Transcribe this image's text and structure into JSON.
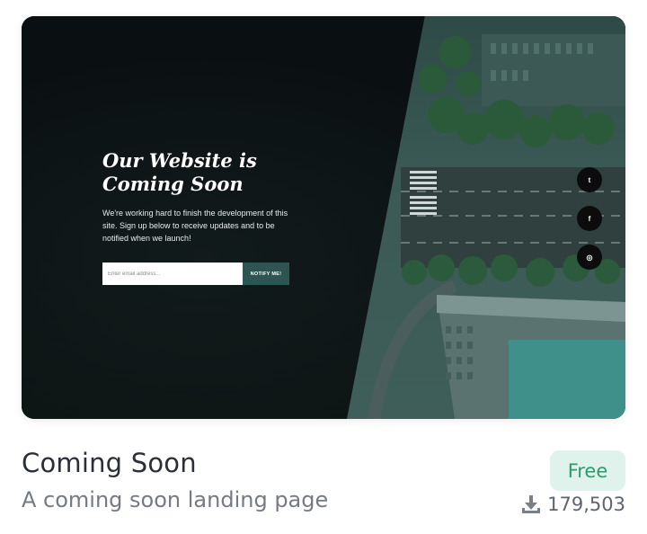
{
  "preview": {
    "headline": "Our Website is Coming Soon",
    "description": "We're working hard to finish the development of this site. Sign up below to receive updates and to be notified when we launch!",
    "email_placeholder": "Enter email address...",
    "notify_label": "NOTIFY ME!",
    "social": {
      "twitter": "twitter-icon",
      "facebook": "facebook-icon",
      "instagram": "instagram-icon",
      "twitter_glyph": "t",
      "facebook_glyph": "f",
      "instagram_glyph": "◎"
    }
  },
  "card": {
    "title": "Coming Soon",
    "subtitle": "A coming soon landing page",
    "badge": "Free",
    "downloads": "179,503"
  },
  "colors": {
    "accent_button": "#2f5552",
    "badge_bg": "#dff3ec",
    "badge_text": "#2f9a6e",
    "title": "#2b2f38",
    "subtitle": "#757a84"
  }
}
